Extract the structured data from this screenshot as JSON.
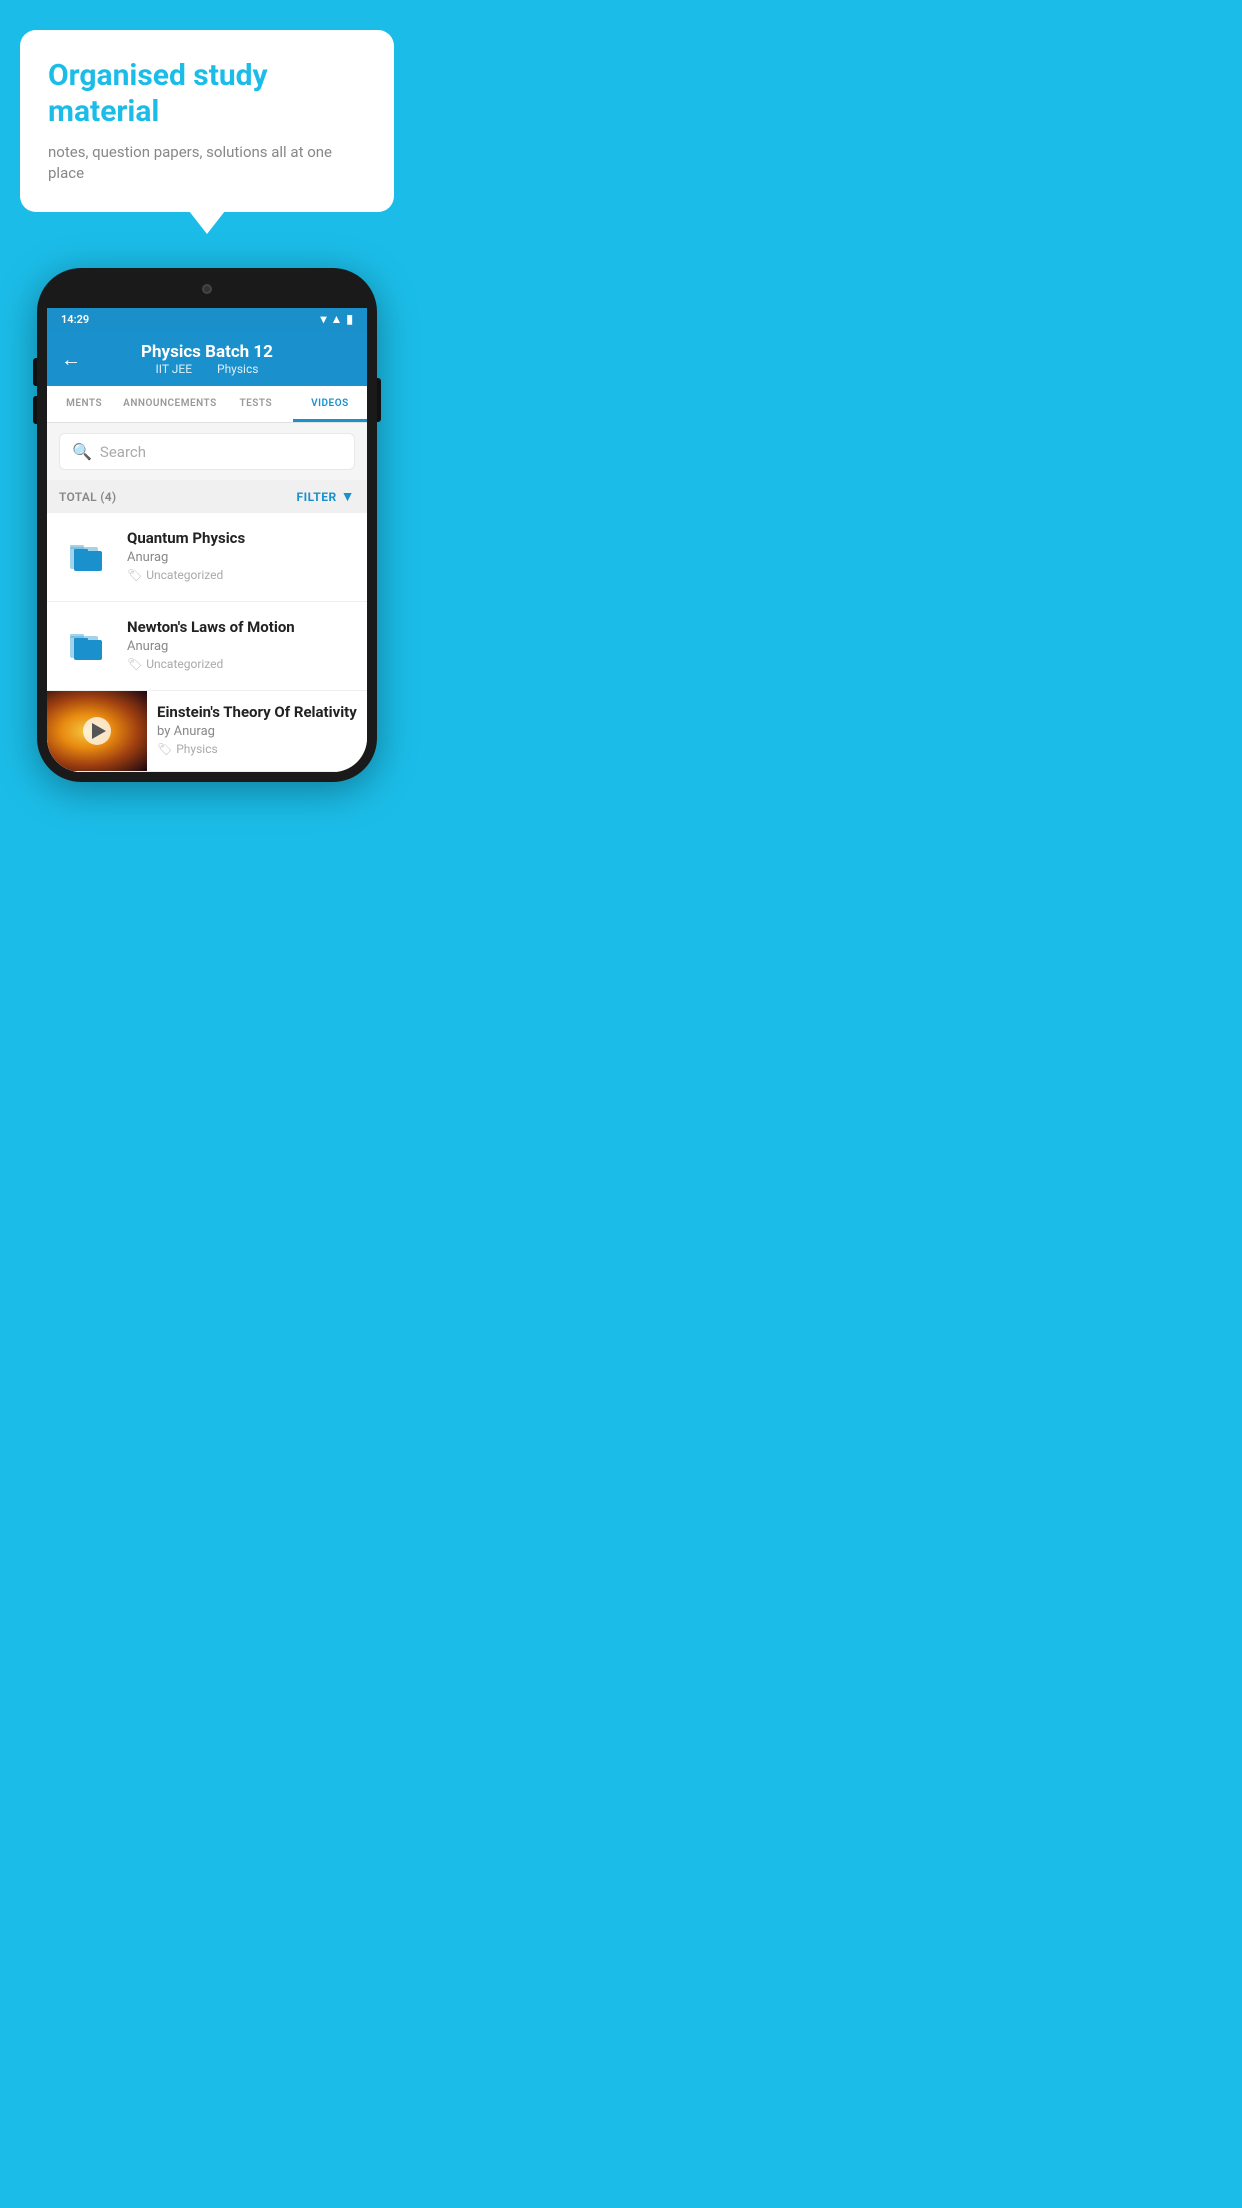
{
  "background_color": "#1BBDE8",
  "speech_bubble": {
    "title": "Organised study material",
    "subtitle": "notes, question papers, solutions all at one place"
  },
  "phone": {
    "status_bar": {
      "time": "14:29",
      "icons": [
        "wifi",
        "signal",
        "battery"
      ]
    },
    "header": {
      "back_label": "←",
      "title": "Physics Batch 12",
      "subtitle_part1": "IIT JEE",
      "subtitle_part2": "Physics"
    },
    "tabs": [
      {
        "label": "MENTS",
        "active": false
      },
      {
        "label": "ANNOUNCEMENTS",
        "active": false
      },
      {
        "label": "TESTS",
        "active": false
      },
      {
        "label": "VIDEOS",
        "active": true
      }
    ],
    "search": {
      "placeholder": "Search"
    },
    "filter_bar": {
      "total_label": "TOTAL (4)",
      "filter_label": "FILTER"
    },
    "video_items": [
      {
        "type": "folder",
        "title": "Quantum Physics",
        "author": "Anurag",
        "tag": "Uncategorized"
      },
      {
        "type": "folder",
        "title": "Newton's Laws of Motion",
        "author": "Anurag",
        "tag": "Uncategorized"
      },
      {
        "type": "video",
        "title": "Einstein's Theory Of Relativity",
        "author": "by Anurag",
        "tag": "Physics"
      }
    ]
  }
}
